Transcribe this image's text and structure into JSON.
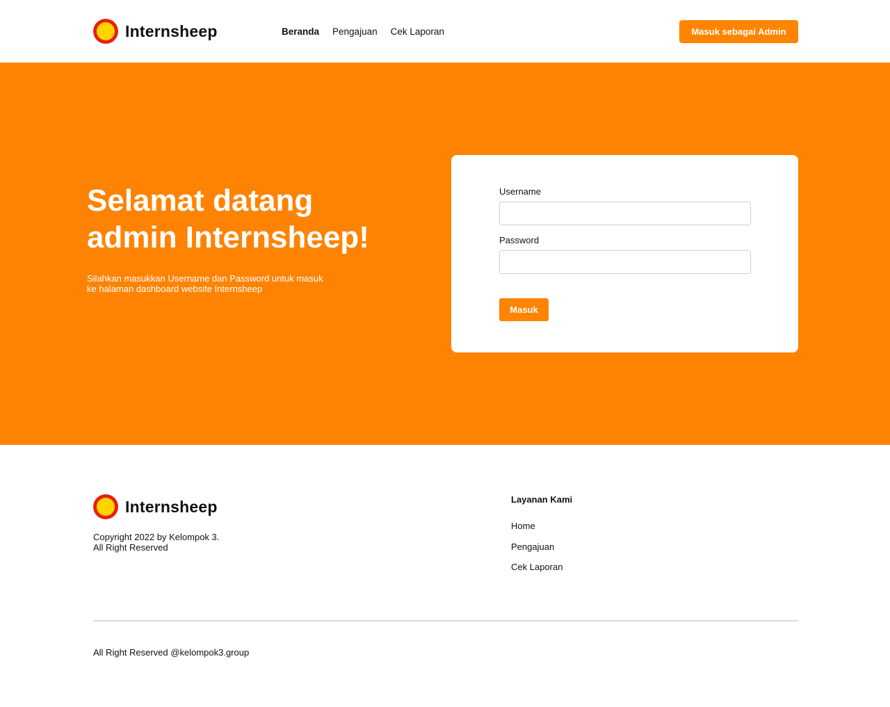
{
  "header": {
    "brand": "Internsheep",
    "nav": [
      {
        "label": "Beranda",
        "active": true
      },
      {
        "label": "Pengajuan",
        "active": false
      },
      {
        "label": "Cek Laporan",
        "active": false
      }
    ],
    "admin_button": "Masuk sebagai Admin"
  },
  "hero": {
    "title_line1": "Selamat datang",
    "title_line2": "admin Internsheep!",
    "subtitle_line1": "Silahkan masukkan Username dan Password untuk masuk",
    "subtitle_line2": "ke halaman dashboard website Internsheep"
  },
  "login": {
    "username_label": "Username",
    "username_value": "",
    "password_label": "Password",
    "password_value": "",
    "submit": "Masuk"
  },
  "footer": {
    "brand": "Internsheep",
    "copyright_line1": "Copyright 2022 by Kelompok 3.",
    "copyright_line2": "All Right Reserved",
    "services_title": "Layanan Kami",
    "services": [
      "Home",
      "Pengajuan",
      "Cek Laporan"
    ],
    "bottom_text": "All Right Reserved @kelompok3.group"
  },
  "colors": {
    "accent": "#ff8400",
    "hero_background": "#ff8303",
    "logo_outer": "#e8200f",
    "logo_inner": "#ffd400"
  }
}
